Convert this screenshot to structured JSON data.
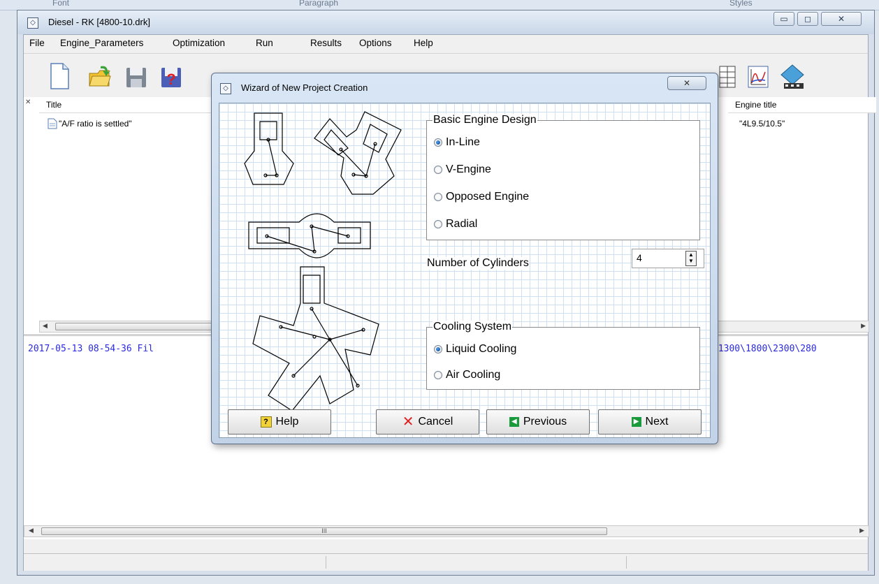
{
  "background_ribbon": {
    "labels": [
      "Font",
      "Paragraph",
      "Styles"
    ]
  },
  "window": {
    "title": "Diesel - RK  [4800-10.drk]",
    "minimize_glyph": "▭",
    "maximize_glyph": "◻",
    "close_glyph": "✕"
  },
  "menu": {
    "items": [
      "File",
      "Engine_Parameters",
      "Optimization",
      "Run",
      "Results",
      "Options",
      "Help"
    ]
  },
  "toolbar": {
    "icons": [
      "new-file-icon",
      "open-folder-icon",
      "save-icon",
      "help-icon",
      "grid-icon",
      "chart-icon",
      "film-icon"
    ]
  },
  "list": {
    "columns": {
      "title": "Title",
      "engine_title": "Engine title"
    },
    "rows": [
      {
        "title": "\"A/F ratio is settled\"",
        "engine_title": "\"4L9.5/10.5\""
      }
    ]
  },
  "log": {
    "left_text": "2017-05-13 08-54-36 Fil",
    "right_text": "\\1300\\1800\\2300\\280"
  },
  "scrollbar_glyph": "III",
  "dialog": {
    "title": "Wizard of New Project Creation",
    "close_glyph": "✕",
    "design_group": {
      "legend": "Basic Engine Design",
      "options": [
        {
          "label": "In-Line",
          "selected": true
        },
        {
          "label": "V-Engine",
          "selected": false
        },
        {
          "label": "Opposed Engine",
          "selected": false
        },
        {
          "label": "Radial",
          "selected": false
        }
      ]
    },
    "cylinders": {
      "label": "Number of Cylinders",
      "value": "4"
    },
    "cooling_group": {
      "legend": "Cooling System",
      "options": [
        {
          "label": "Liquid Cooling",
          "selected": true
        },
        {
          "label": "Air Cooling",
          "selected": false
        }
      ]
    },
    "buttons": {
      "help": "Help",
      "cancel": "Cancel",
      "previous": "Previous",
      "next": "Next"
    },
    "colors": {
      "cancel_x": "#e02020",
      "nav_green": "#1a9a3a",
      "help_yellow": "#f2d23a"
    }
  }
}
